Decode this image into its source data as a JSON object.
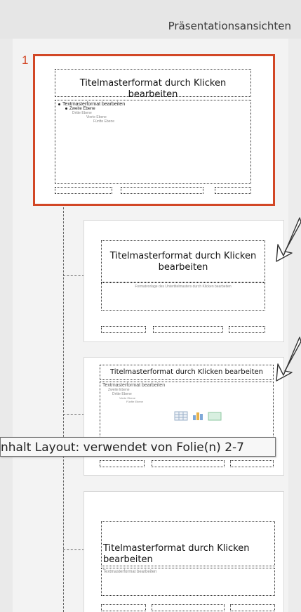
{
  "header": {
    "title": "Präsentationsansichten"
  },
  "thumbnails": {
    "master_number": "1",
    "master": {
      "title": "Titelmasterformat durch Klicken bearbeiten",
      "body_lines": [
        "Textmasterformat bearbeiten",
        "Zweite Ebene",
        "Dritte Ebene",
        "Vierte Ebene",
        "Fünfte Ebene"
      ]
    },
    "layout1": {
      "title": "Titelmasterformat durch Klicken bearbeiten",
      "subtitle": "Formatvorlage des Untertitelmasters durch Klicken bearbeiten"
    },
    "layout2": {
      "title": "Titelmasterformat durch Klicken bearbeiten",
      "body_lines": [
        "Textmasterformat bearbeiten",
        "Zweite Ebene",
        "Dritte Ebene",
        "Vierte Ebene",
        "Fünfte Ebene"
      ]
    },
    "layout3": {
      "title": "Titelmasterformat durch Klicken bearbeiten",
      "body": "Textmasterformat bearbeiten"
    }
  },
  "tooltip": {
    "text": "nhalt Layout: verwendet von Folie(n) 2-7"
  },
  "colors": {
    "accent": "#d24726"
  }
}
